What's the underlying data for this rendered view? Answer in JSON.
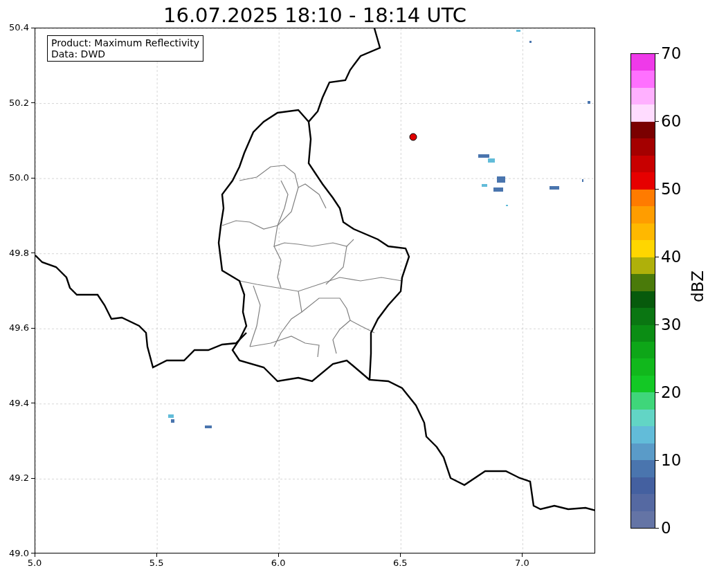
{
  "title": "16.07.2025 18:10 - 18:14 UTC",
  "legend": [
    "Product: Maximum Reflectivity",
    "Data: DWD"
  ],
  "x_ticks": [
    "5.0",
    "5.5",
    "6.0",
    "6.5",
    "7.0"
  ],
  "y_ticks": [
    "50.4",
    "50.2",
    "50.0",
    "49.8",
    "49.6",
    "49.4",
    "49.2",
    "49.0"
  ],
  "colorbar": {
    "label": "dBZ",
    "ticks": [
      "70",
      "60",
      "50",
      "40",
      "30",
      "20",
      "10",
      "0"
    ],
    "segments": [
      {
        "color": "#ef3ae9"
      },
      {
        "color": "#ff70ff"
      },
      {
        "color": "#ffb0ff"
      },
      {
        "color": "#ffdcff"
      },
      {
        "color": "#7a0000"
      },
      {
        "color": "#a40000"
      },
      {
        "color": "#c80000"
      },
      {
        "color": "#e60000"
      },
      {
        "color": "#ff7b00"
      },
      {
        "color": "#ff9d00"
      },
      {
        "color": "#ffb800"
      },
      {
        "color": "#ffd600"
      },
      {
        "color": "#afb00a"
      },
      {
        "color": "#4a7a0a"
      },
      {
        "color": "#075a0c"
      },
      {
        "color": "#0a7612"
      },
      {
        "color": "#0b8d14"
      },
      {
        "color": "#0ea618"
      },
      {
        "color": "#11b81c"
      },
      {
        "color": "#13c825"
      },
      {
        "color": "#3fd67a"
      },
      {
        "color": "#62d5c5"
      },
      {
        "color": "#62bcd9"
      },
      {
        "color": "#5a9bc8"
      },
      {
        "color": "#4a75ae"
      },
      {
        "color": "#4460a0"
      },
      {
        "color": "#5569a2"
      },
      {
        "color": "#6474a5"
      }
    ]
  }
}
